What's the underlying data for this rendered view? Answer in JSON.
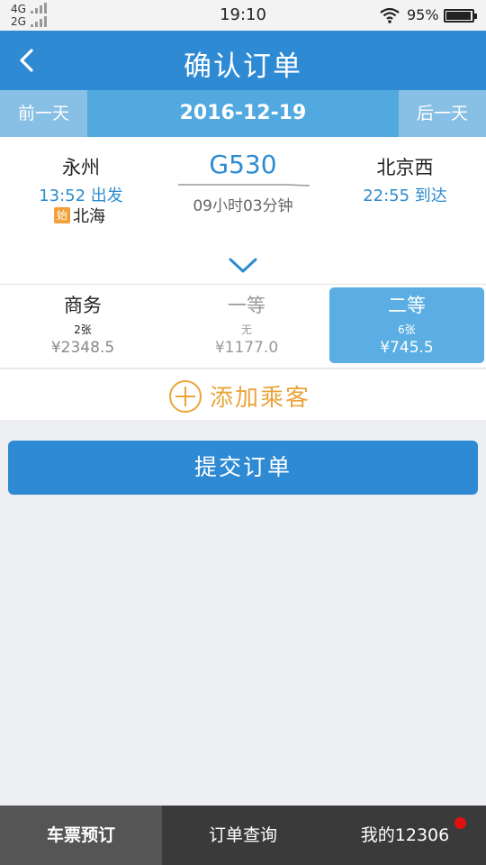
{
  "status_bar": {
    "net1": "4G",
    "net2": "2G",
    "time": "19:10",
    "battery": "95%",
    "icons": [
      "signal-icon",
      "wifi-icon",
      "battery-icon"
    ]
  },
  "nav": {
    "title": "确认订单",
    "back_icon": "chevron-left-icon"
  },
  "date_bar": {
    "prev_label": "前一天",
    "date": "2016-12-19",
    "next_label": "后一天"
  },
  "train": {
    "from_station": "永州",
    "from_time": "13:52 出发",
    "origin_badge": "始",
    "origin_name": "北海",
    "train_no": "G530",
    "duration": "09小时03分钟",
    "to_station": "北京西",
    "to_time": "22:55 到达",
    "expand_icon": "chevron-down-icon"
  },
  "seats": [
    {
      "name": "商务",
      "count": "2张",
      "price": "¥2348.5",
      "selected": false
    },
    {
      "name": "一等",
      "count": "无",
      "price": "¥1177.0",
      "selected": false
    },
    {
      "name": "二等",
      "count": "6张",
      "price": "¥745.5",
      "selected": true
    }
  ],
  "add_passenger": {
    "label": "添加乘客",
    "icon": "plus-circle-icon"
  },
  "submit": {
    "label": "提交订单"
  },
  "tabs": [
    {
      "label": "车票预订",
      "active": true
    },
    {
      "label": "订单查询",
      "active": false
    },
    {
      "label": "我的12306",
      "active": false,
      "badge": true
    }
  ],
  "colors": {
    "primary": "#2f8ad4",
    "date_bar": "#52a9df",
    "selected_seat": "#5aaee3",
    "accent": "#eaa43a",
    "badge_dot": "#e01010"
  }
}
